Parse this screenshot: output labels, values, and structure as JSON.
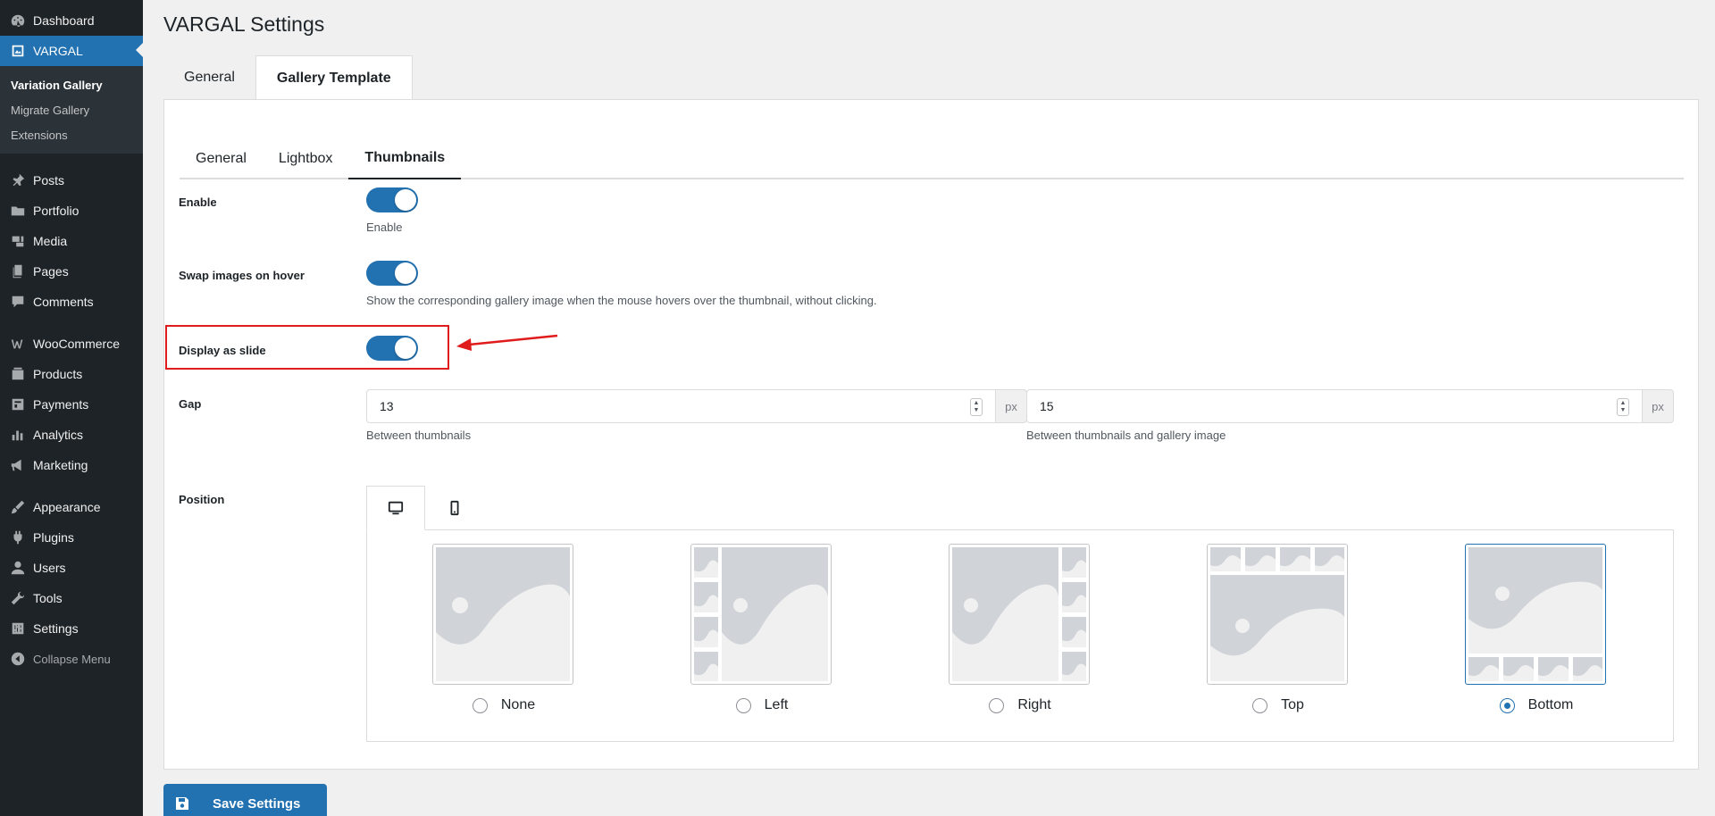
{
  "sidebar": {
    "top_items": [
      {
        "label": "Dashboard",
        "icon": "dashboard-icon"
      },
      {
        "label": "VARGAL",
        "icon": "vargal-icon"
      }
    ],
    "submenu": [
      "Variation Gallery",
      "Migrate Gallery",
      "Extensions"
    ],
    "group2": [
      {
        "label": "Posts",
        "icon": "pin-icon"
      },
      {
        "label": "Portfolio",
        "icon": "folder-icon"
      },
      {
        "label": "Media",
        "icon": "media-icon"
      },
      {
        "label": "Pages",
        "icon": "pages-icon"
      },
      {
        "label": "Comments",
        "icon": "comment-icon"
      }
    ],
    "group3": [
      {
        "label": "WooCommerce",
        "icon": "woocommerce-icon"
      },
      {
        "label": "Products",
        "icon": "products-icon"
      },
      {
        "label": "Payments",
        "icon": "payments-icon"
      },
      {
        "label": "Analytics",
        "icon": "analytics-icon"
      },
      {
        "label": "Marketing",
        "icon": "megaphone-icon"
      }
    ],
    "group4": [
      {
        "label": "Appearance",
        "icon": "brush-icon"
      },
      {
        "label": "Plugins",
        "icon": "plug-icon"
      },
      {
        "label": "Users",
        "icon": "user-icon"
      },
      {
        "label": "Tools",
        "icon": "wrench-icon"
      },
      {
        "label": "Settings",
        "icon": "sliders-icon"
      }
    ],
    "collapse": "Collapse Menu"
  },
  "page": {
    "title": "VARGAL Settings",
    "outer_tabs": [
      "General",
      "Gallery Template"
    ],
    "inner_tabs": [
      "General",
      "Lightbox",
      "Thumbnails"
    ]
  },
  "settings": {
    "enable": {
      "label": "Enable",
      "desc": "Enable",
      "on": true
    },
    "swap": {
      "label": "Swap images on hover",
      "desc": "Show the corresponding gallery image when the mouse hovers over the thumbnail, without clicking.",
      "on": true
    },
    "slide": {
      "label": "Display as slide",
      "on": true
    },
    "gap": {
      "label": "Gap",
      "thumbs_value": "13",
      "thumbs_unit": "px",
      "thumbs_desc": "Between thumbnails",
      "gallery_value": "15",
      "gallery_unit": "px",
      "gallery_desc": "Between thumbnails and gallery image"
    },
    "position": {
      "label": "Position",
      "devices": [
        "desktop-icon",
        "mobile-icon"
      ],
      "options": [
        "None",
        "Left",
        "Right",
        "Top",
        "Bottom"
      ],
      "selected": "Bottom"
    }
  },
  "actions": {
    "save_label": "Save Settings"
  },
  "colors": {
    "accent": "#2271b1",
    "sidebar": "#1d2327",
    "highlight": "#e01b1b"
  }
}
